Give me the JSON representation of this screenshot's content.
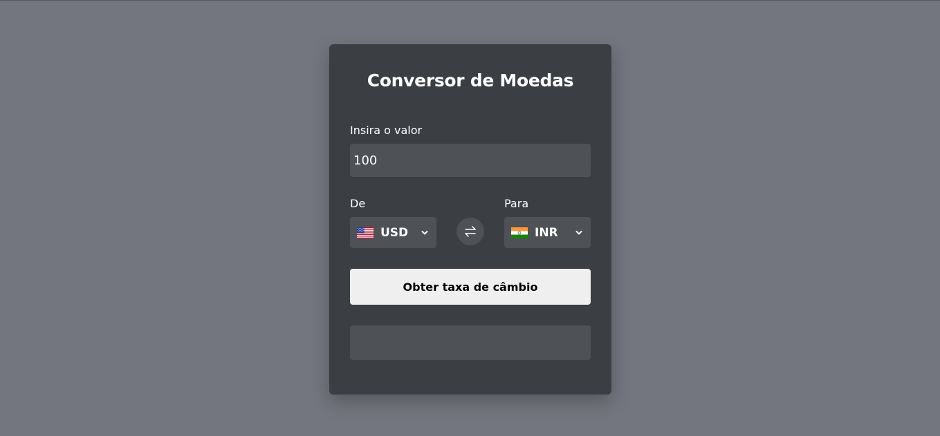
{
  "converter": {
    "title": "Conversor de Moedas",
    "amount_label": "Insira o valor",
    "amount_value": "100",
    "from_label": "De",
    "from_currency": "USD",
    "from_flag": "us-flag-icon",
    "swap_icon": "swap-arrows-icon",
    "to_label": "Para",
    "to_currency": "INR",
    "to_flag": "india-flag-icon",
    "button_label": "Obter taxa de câmbio",
    "result_text": ""
  },
  "colors": {
    "page_background": "#73767e",
    "card_background": "#3b3e43",
    "field_background": "#4e5156",
    "button_background": "#efefef",
    "text": "#ffffff"
  }
}
